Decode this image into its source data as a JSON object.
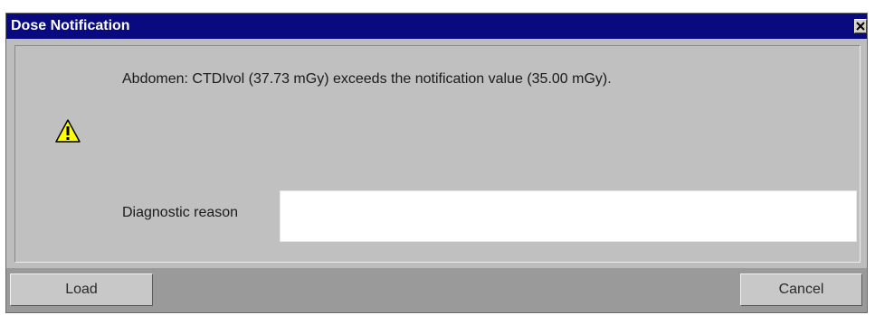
{
  "window": {
    "title": "Dose Notification",
    "close_icon": "close-icon"
  },
  "dialog": {
    "icon": "warning-icon",
    "message": "Abdomen: CTDIvol (37.73 mGy) exceeds the notification value (35.00 mGy).",
    "reason_label": "Diagnostic reason",
    "reason_value": ""
  },
  "buttons": {
    "load_label": "Load",
    "cancel_label": "Cancel"
  },
  "colors": {
    "titlebar": "#0a0a80",
    "dialog_bg": "#c0c0c0",
    "footer_bg": "#9a9a9a",
    "warning_yellow": "#ffff00"
  }
}
